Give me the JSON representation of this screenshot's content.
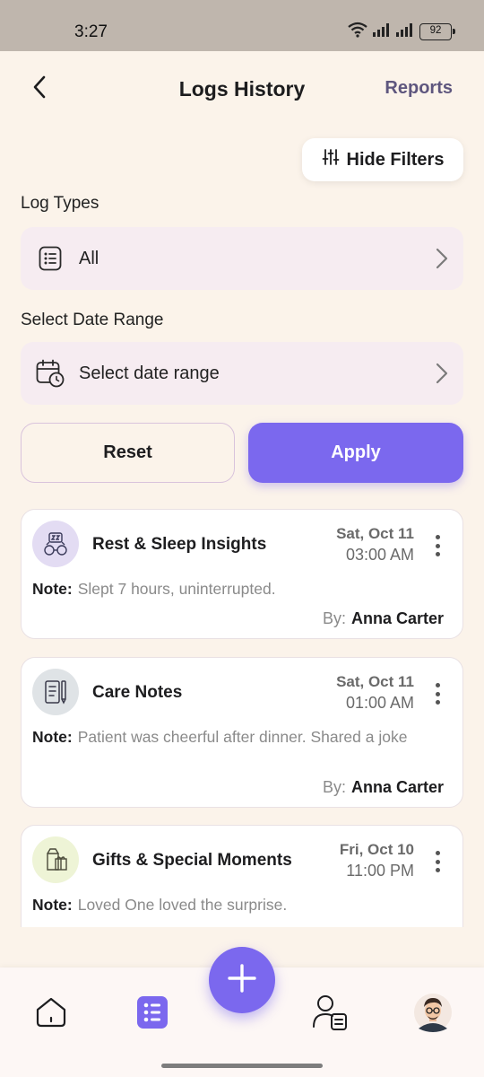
{
  "status_bar": {
    "time": "3:27",
    "battery": "92"
  },
  "header": {
    "title": "Logs History",
    "reports_label": "Reports"
  },
  "filters": {
    "toggle_label": "Hide Filters",
    "log_types_label": "Log Types",
    "log_types_value": "All",
    "date_range_label": "Select Date Range",
    "date_range_placeholder": "Select date range",
    "reset_label": "Reset",
    "apply_label": "Apply"
  },
  "logs": [
    {
      "title": "Rest & Sleep Insights",
      "date": "Sat, Oct 11",
      "time": "03:00 AM",
      "note_label": "Note:",
      "note": "Slept 7 hours, uninterrupted.",
      "by_label": "By:",
      "author": "Anna Carter",
      "icon": "sleep-icon",
      "icon_bg": "#e3dcf3"
    },
    {
      "title": "Care Notes",
      "date": "Sat, Oct 11",
      "time": "01:00 AM",
      "note_label": "Note:",
      "note": "Patient was cheerful after dinner. Shared a joke",
      "by_label": "By:",
      "author": "Anna Carter",
      "icon": "notes-icon",
      "icon_bg": "#dfe3e6"
    },
    {
      "title": "Gifts & Special Moments",
      "date": "Fri, Oct 10",
      "time": "11:00 PM",
      "note_label": "Note:",
      "note": "Loved One loved the surprise.",
      "icon": "gift-icon",
      "icon_bg": "#eef4d6"
    }
  ],
  "nav": {
    "items": [
      "home-icon",
      "logs-icon",
      "caregiver-icon",
      "profile-avatar"
    ],
    "active": "logs-icon"
  },
  "colors": {
    "accent": "#7b68ee",
    "background": "#fbf3ea",
    "reports": "#5e567e"
  }
}
